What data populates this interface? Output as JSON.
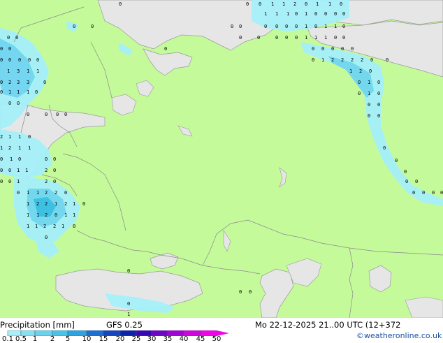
{
  "footer": {
    "title": "Precipitation [mm]",
    "model": "GFS 0.25",
    "datetime": "Mo 22-12-2025 21..00 UTC (12+372",
    "credit": "©weatheronline.co.uk"
  },
  "legend": {
    "labels": [
      "0.1",
      "0.5",
      "1",
      "2",
      "5",
      "10",
      "15",
      "20",
      "25",
      "30",
      "35",
      "40",
      "45",
      "50"
    ],
    "colors": [
      "#a5f0fa",
      "#87e1f5",
      "#69d2ef",
      "#4bc3e9",
      "#2da3e0",
      "#1d6fd1",
      "#1446c0",
      "#0c24ac",
      "#3a07b8",
      "#6e06c8",
      "#a005d6",
      "#cf04e0",
      "#f204ea"
    ]
  },
  "colors": {
    "land": "#c5fa9b",
    "sea": "#e6e6e6",
    "precip_light": "#a5f0fa",
    "precip_mid": "#6fd6f2",
    "precip_heavy": "#36bde6",
    "border": "#9a9a9a"
  },
  "grid_values": [
    {
      "r": "top",
      "v": "0 0 1 1 0 1 1 1 0"
    },
    {
      "r": "barents",
      "v": "0 1 0 0 1 0 0 0"
    },
    {
      "r": "kola",
      "v": "0 0 0 0 1 1 1 0"
    },
    {
      "r": "norway",
      "v": "0 0 0 1 0 0 0"
    }
  ]
}
